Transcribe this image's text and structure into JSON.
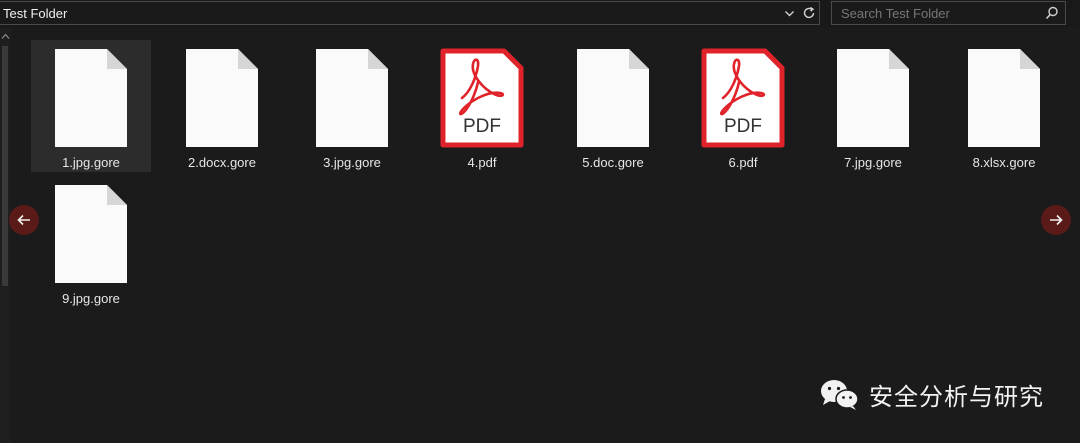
{
  "address_bar": {
    "path": "Test Folder"
  },
  "search": {
    "placeholder": "Search Test Folder"
  },
  "files": [
    {
      "name": "1.jpg.gore",
      "icon": "generic-file-icon",
      "selected": true
    },
    {
      "name": "2.docx.gore",
      "icon": "generic-file-icon"
    },
    {
      "name": "3.jpg.gore",
      "icon": "generic-file-icon"
    },
    {
      "name": "4.pdf",
      "icon": "pdf-file-icon"
    },
    {
      "name": "5.doc.gore",
      "icon": "generic-file-icon"
    },
    {
      "name": "6.pdf",
      "icon": "pdf-file-icon"
    },
    {
      "name": "7.jpg.gore",
      "icon": "generic-file-icon"
    },
    {
      "name": "8.xlsx.gore",
      "icon": "generic-file-icon"
    },
    {
      "name": "9.jpg.gore",
      "icon": "generic-file-icon"
    }
  ],
  "pdf_icon_text": "PDF",
  "watermark": {
    "text": "安全分析与研究",
    "icon": "wechat-icon"
  },
  "colors": {
    "background": "#1b1b1b",
    "pdf_red": "#e0232a",
    "nav_button": "#5a1a17"
  }
}
